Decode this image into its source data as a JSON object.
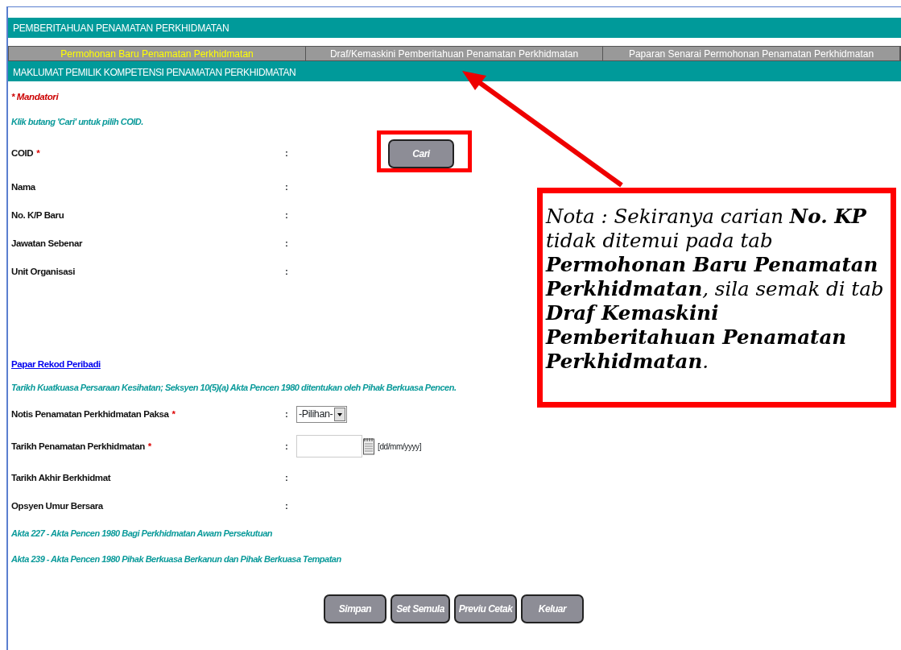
{
  "header": {
    "title": "PEMBERITAHUAN PENAMATAN PERKHIDMATAN"
  },
  "tabs": [
    {
      "label": "Permohonan Baru Penamatan Perkhidmatan",
      "selected": true
    },
    {
      "label": "Draf/Kemaskini Pemberitahuan Penamatan Perkhidmatan",
      "selected": false
    },
    {
      "label": "Paparan Senarai Permohonan Penamatan Perkhidmatan",
      "selected": false
    }
  ],
  "section_title": "MAKLUMAT PEMILIK KOMPETENSI PENAMATAN PERKHIDMATAN",
  "rows": [
    {
      "kind": "required_note",
      "text": "* Mandatori"
    },
    {
      "kind": "hint",
      "text": "Klik butang 'Cari' untuk pilih COID."
    },
    {
      "kind": "button_field",
      "label": "COID",
      "required_mark": "*",
      "separator": ":",
      "button": "Cari"
    },
    {
      "kind": "field",
      "label": "Nama",
      "separator": ":"
    },
    {
      "kind": "field",
      "label": "No. K/P Baru",
      "separator": ":"
    },
    {
      "kind": "field",
      "label": "Jawatan Sebenar",
      "separator": ":"
    },
    {
      "kind": "field",
      "label": "Unit Organisasi",
      "separator": ":"
    },
    {
      "kind": "link",
      "text": "Papar Rekod Peribadi"
    },
    {
      "kind": "hint",
      "text": "Tarikh Kuatkuasa Persaraan Kesihatan; Seksyen 10(5)(a) Akta Pencen 1980 ditentukan oleh Pihak Berkuasa Pencen."
    },
    {
      "kind": "select_field",
      "label": "Notis Penamatan Perkhidmatan Paksa",
      "required_mark": "*",
      "separator": ":",
      "value": "-Pilihan-"
    },
    {
      "kind": "date_field",
      "label": "Tarikh Penamatan Perkhidmatan",
      "required_mark": "*",
      "separator": ":",
      "format": "[dd/mm/yyyy]"
    },
    {
      "kind": "field",
      "label": "Tarikh Akhir Berkhidmat",
      "separator": ":"
    },
    {
      "kind": "field",
      "label": "Opsyen Umur Bersara",
      "separator": ":"
    },
    {
      "kind": "hint",
      "text": "Akta 227 - Akta Pencen 1980 Bagi Perkhidmatan Awam Persekutuan"
    },
    {
      "kind": "hint",
      "text": "Akta 239 - Akta Pencen 1980 Pihak Berkuasa Berkanun dan Pihak Berkuasa Tempatan"
    }
  ],
  "buttons": [
    "Simpan",
    "Set Semula",
    "Previu Cetak",
    "Keluar"
  ],
  "callout": {
    "text": "Nota : Sekiranya carian **No. KP** tidak ditemui pada tab **Permohonan Baru Penamatan Perkhidmatan**, sila semak di tab **Draf Kemaskini Pemberitahuan Penamatan Perkhidmatan**."
  }
}
